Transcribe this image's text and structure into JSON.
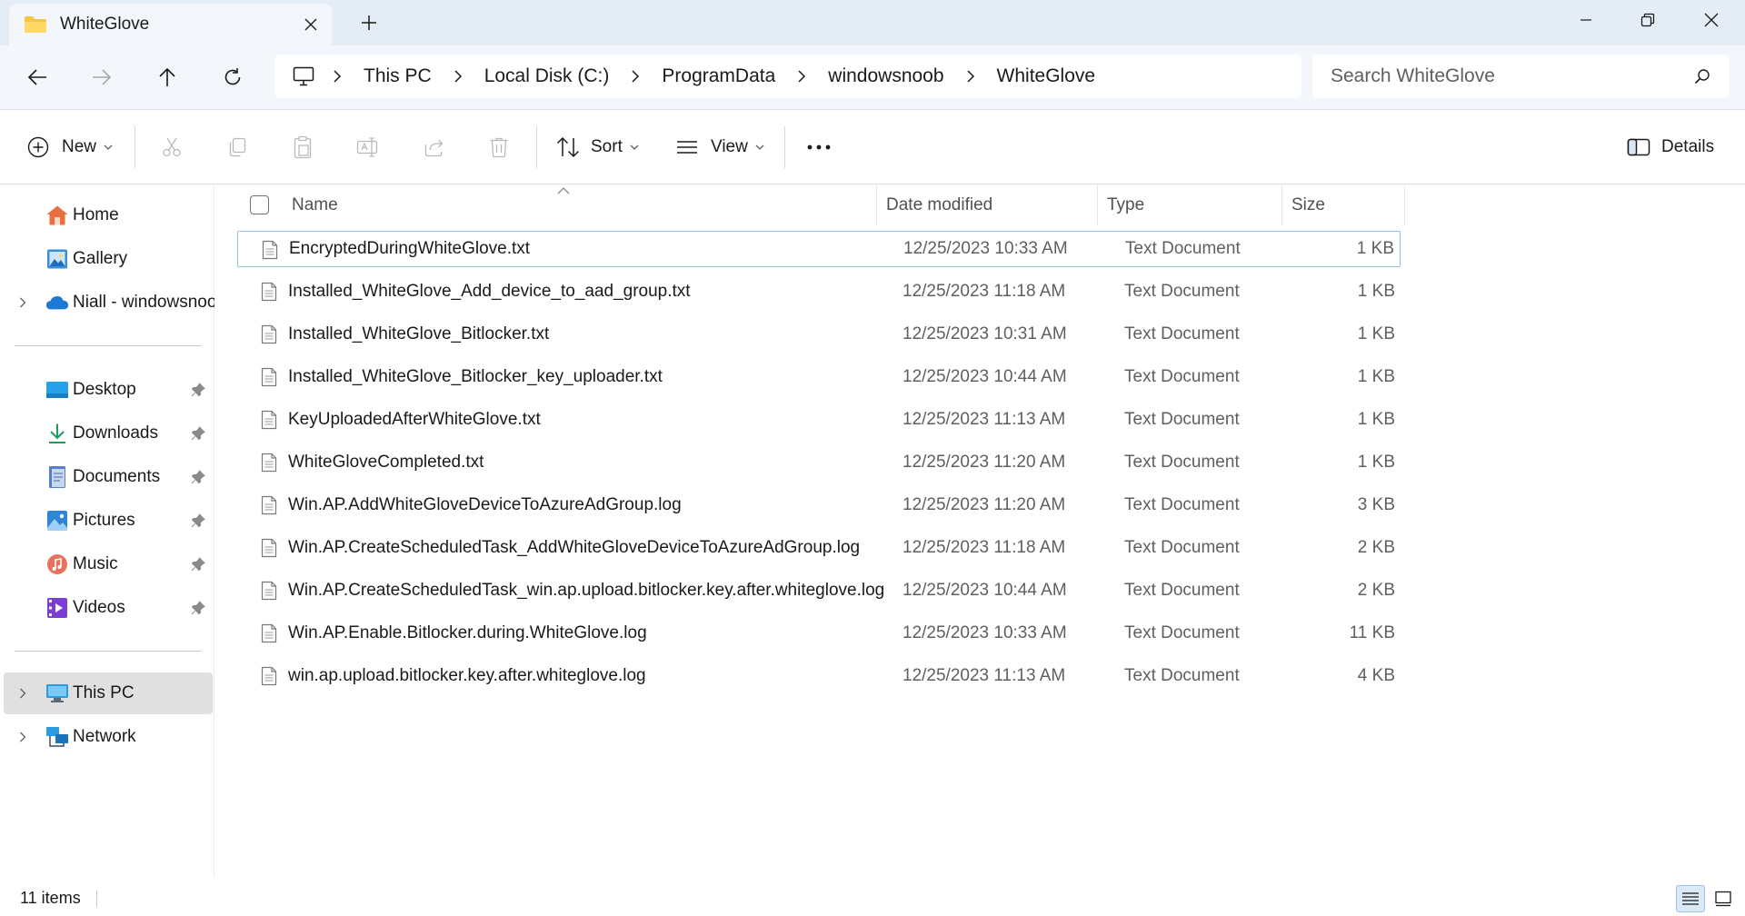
{
  "window": {
    "tab_title": "WhiteGlove",
    "new_tab_label": "+"
  },
  "address": {
    "segments": [
      "This PC",
      "Local Disk (C:)",
      "ProgramData",
      "windowsnoob",
      "WhiteGlove"
    ]
  },
  "search": {
    "placeholder": "Search WhiteGlove"
  },
  "commands": {
    "new_label": "New",
    "sort_label": "Sort",
    "view_label": "View",
    "details_label": "Details"
  },
  "sidebar": {
    "items": [
      {
        "label": "Home",
        "icon": "home-icon"
      },
      {
        "label": "Gallery",
        "icon": "gallery-icon"
      },
      {
        "label": "Niall - windowsnoob",
        "icon": "onedrive-icon"
      },
      {
        "label": "Desktop",
        "icon": "desktop-icon"
      },
      {
        "label": "Downloads",
        "icon": "downloads-icon"
      },
      {
        "label": "Documents",
        "icon": "documents-icon"
      },
      {
        "label": "Pictures",
        "icon": "pictures-icon"
      },
      {
        "label": "Music",
        "icon": "music-icon"
      },
      {
        "label": "Videos",
        "icon": "videos-icon"
      },
      {
        "label": "This PC",
        "icon": "this-pc-icon"
      },
      {
        "label": "Network",
        "icon": "network-icon"
      }
    ]
  },
  "columns": {
    "name": "Name",
    "date": "Date modified",
    "type": "Type",
    "size": "Size"
  },
  "files": [
    {
      "name": "EncryptedDuringWhiteGlove.txt",
      "date": "12/25/2023 10:33 AM",
      "type": "Text Document",
      "size": "1 KB"
    },
    {
      "name": "Installed_WhiteGlove_Add_device_to_aad_group.txt",
      "date": "12/25/2023 11:18 AM",
      "type": "Text Document",
      "size": "1 KB"
    },
    {
      "name": "Installed_WhiteGlove_Bitlocker.txt",
      "date": "12/25/2023 10:31 AM",
      "type": "Text Document",
      "size": "1 KB"
    },
    {
      "name": "Installed_WhiteGlove_Bitlocker_key_uploader.txt",
      "date": "12/25/2023 10:44 AM",
      "type": "Text Document",
      "size": "1 KB"
    },
    {
      "name": "KeyUploadedAfterWhiteGlove.txt",
      "date": "12/25/2023 11:13 AM",
      "type": "Text Document",
      "size": "1 KB"
    },
    {
      "name": "WhiteGloveCompleted.txt",
      "date": "12/25/2023 11:20 AM",
      "type": "Text Document",
      "size": "1 KB"
    },
    {
      "name": "Win.AP.AddWhiteGloveDeviceToAzureAdGroup.log",
      "date": "12/25/2023 11:20 AM",
      "type": "Text Document",
      "size": "3 KB"
    },
    {
      "name": "Win.AP.CreateScheduledTask_AddWhiteGloveDeviceToAzureAdGroup.log",
      "date": "12/25/2023 11:18 AM",
      "type": "Text Document",
      "size": "2 KB"
    },
    {
      "name": "Win.AP.CreateScheduledTask_win.ap.upload.bitlocker.key.after.whiteglove.log",
      "date": "12/25/2023 10:44 AM",
      "type": "Text Document",
      "size": "2 KB"
    },
    {
      "name": "Win.AP.Enable.Bitlocker.during.WhiteGlove.log",
      "date": "12/25/2023 10:33 AM",
      "type": "Text Document",
      "size": "11 KB"
    },
    {
      "name": "win.ap.upload.bitlocker.key.after.whiteglove.log",
      "date": "12/25/2023 11:13 AM",
      "type": "Text Document",
      "size": "4 KB"
    }
  ],
  "status": {
    "item_count": "11 items"
  },
  "colors": {
    "titlebar": "#e4ecf5",
    "toolbar": "#f3f6fb",
    "accent": "#0067c0",
    "focus_border": "#8fc2ea"
  }
}
